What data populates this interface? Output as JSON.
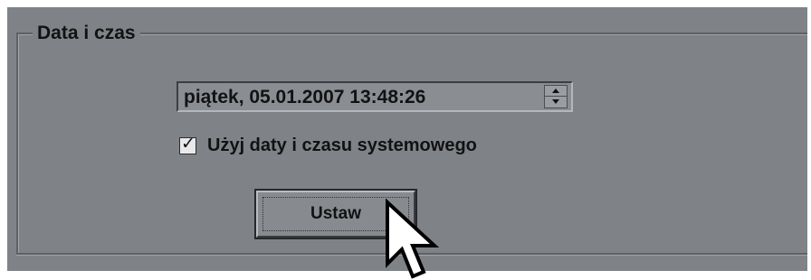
{
  "group": {
    "title": "Data i czas"
  },
  "datetime_picker": {
    "value": "piątek, 05.01.2007 13:48:26"
  },
  "system_time_checkbox": {
    "label": "Użyj daty i czasu systemowego",
    "checked": true
  },
  "set_button": {
    "label": "Ustaw"
  },
  "icons": {
    "spinner_up": "chevron-up-icon",
    "spinner_down": "chevron-down-icon",
    "checkmark": "check-icon",
    "cursor": "mouse-pointer-icon"
  },
  "colors": {
    "panel_background": "#7f8388",
    "text": "#121212"
  }
}
